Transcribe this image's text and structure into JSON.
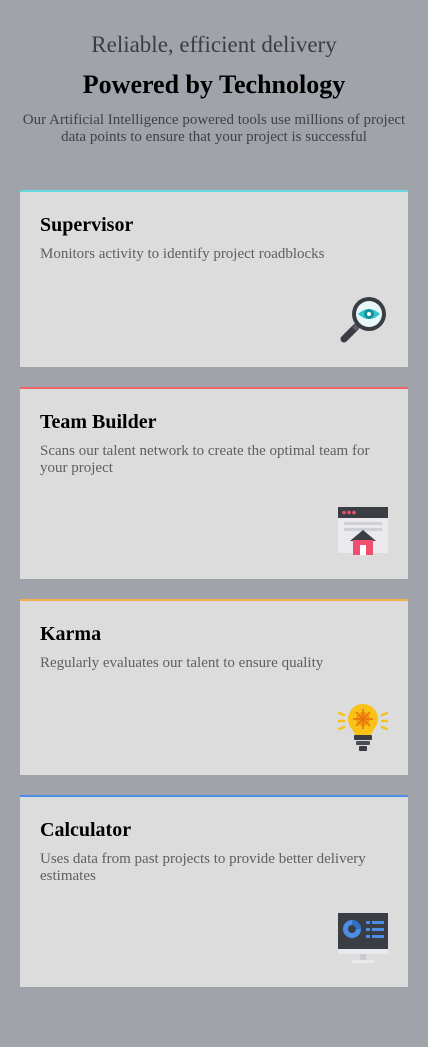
{
  "header": {
    "subtitle": "Reliable, efficient delivery",
    "title": "Powered by Technology",
    "description": "Our Artificial Intelligence powered tools use millions of project data points to ensure that your project is successful"
  },
  "cards": [
    {
      "title": "Supervisor",
      "description": "Monitors activity to identify project roadblocks",
      "accent_color": "#66d9e0",
      "icon": "magnifier-eye-icon"
    },
    {
      "title": "Team Builder",
      "description": "Scans our talent network to create the optimal team for your project",
      "accent_color": "#f06565",
      "icon": "browser-home-icon"
    },
    {
      "title": "Karma",
      "description": "Regularly evaluates our talent to ensure quality",
      "accent_color": "#f3b04a",
      "icon": "lightbulb-icon"
    },
    {
      "title": "Calculator",
      "description": "Uses data from past projects to provide better delivery estimates",
      "accent_color": "#4c8ee6",
      "icon": "monitor-chart-icon"
    }
  ]
}
